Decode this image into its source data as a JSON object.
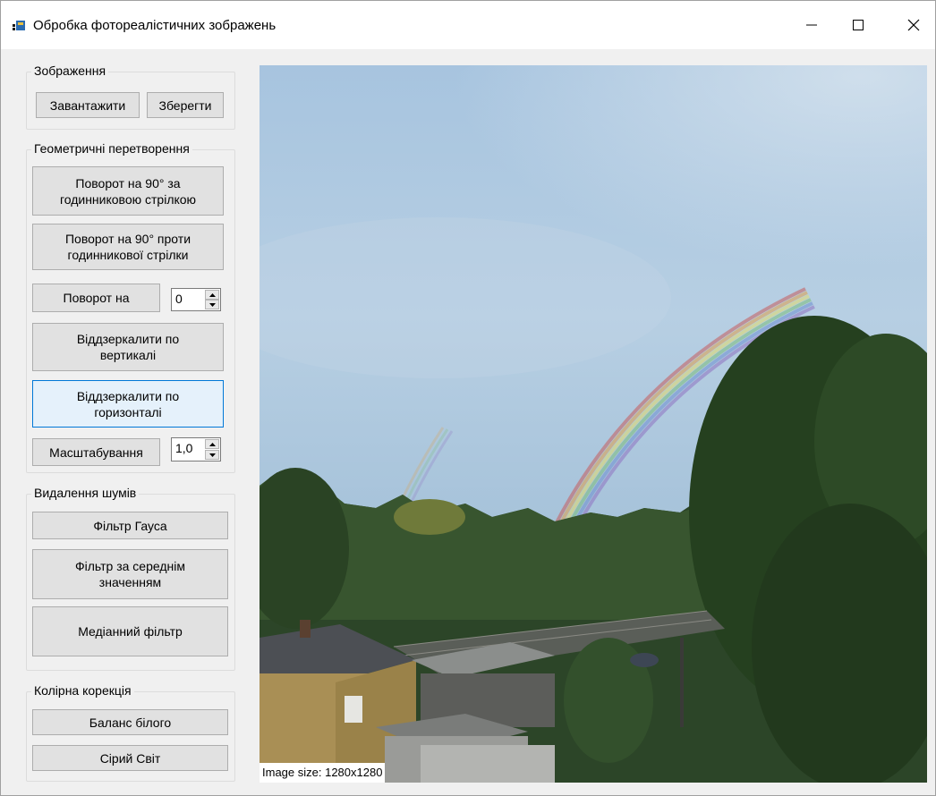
{
  "window": {
    "title": "Обробка фотореалістичних зображень"
  },
  "groups": {
    "image": {
      "label": "Зображення",
      "load": "Завантажити",
      "save": "Зберегти"
    },
    "geometry": {
      "label": "Геометричні перетворення",
      "rotate_cw": "Поворот на 90° за\nгодинниковою стрілкою",
      "rotate_ccw": "Поворот на 90° проти\nгодинникової стрілки",
      "rotate_by": "Поворот на",
      "rotate_value": "0",
      "flip_vertical": "Віддзеркалити по\nвертикалі",
      "flip_horizontal": "Віддзеркалити по\nгоризонталі",
      "scale": "Масштабування",
      "scale_value": "1,0"
    },
    "noise": {
      "label": "Видалення шумів",
      "gauss": "Фільтр Гауса",
      "mean": "Фільтр за середнім\nзначенням",
      "median": "Медіанний фільтр"
    },
    "color": {
      "label": "Колірна корекція",
      "white_balance": "Баланс білого",
      "gray_world": "Сірий Світ"
    }
  },
  "image": {
    "size_label": "Image size: 1280x1280"
  }
}
